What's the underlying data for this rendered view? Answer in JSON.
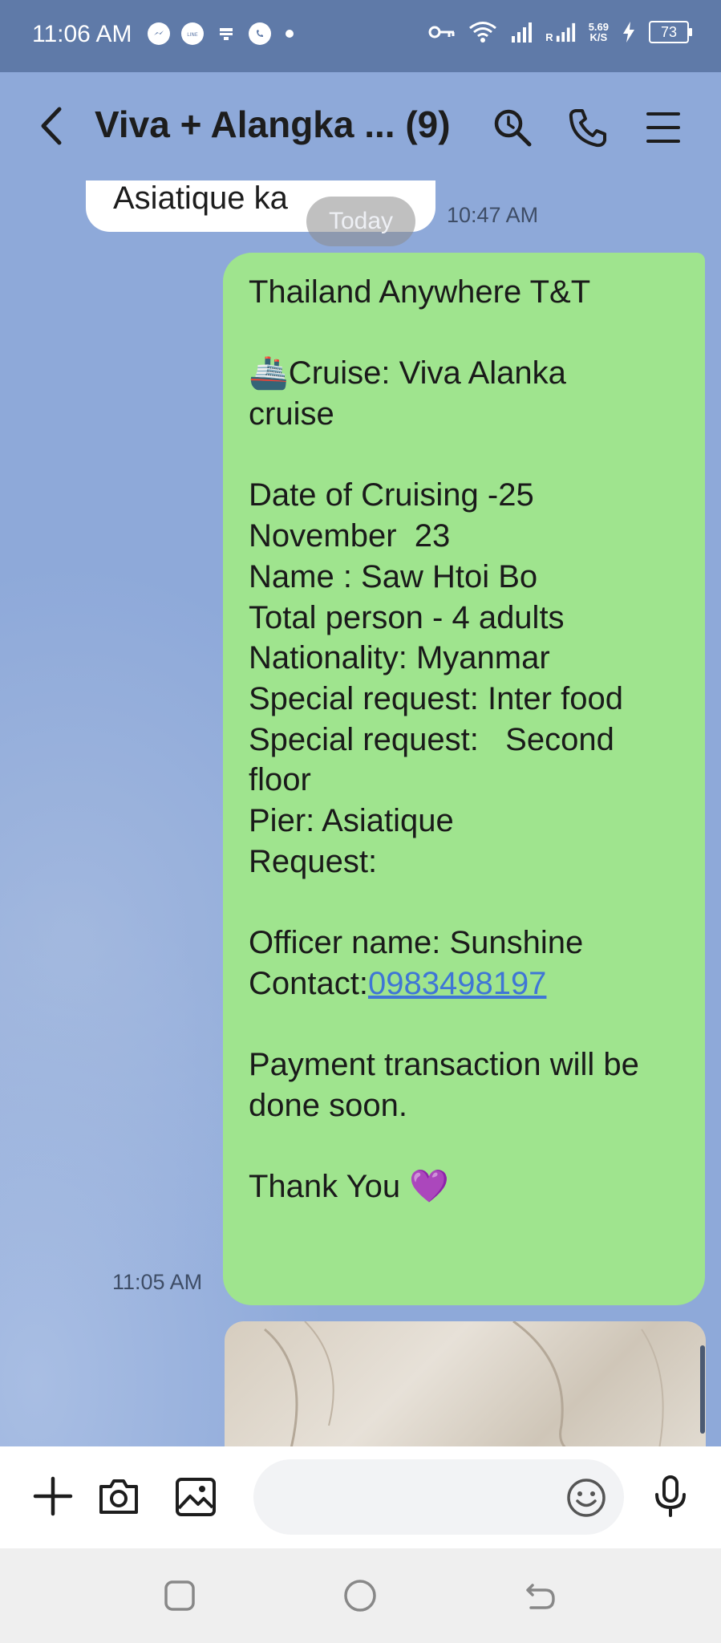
{
  "status_bar": {
    "time": "11:06 AM",
    "left_icons": [
      "messenger-icon",
      "line-icon",
      "notification-icon",
      "viber-icon"
    ],
    "network_speed": "5.69",
    "network_speed_unit": "K/S",
    "roaming_label": "R",
    "battery": "73"
  },
  "header": {
    "title": "Viva + Alangka ... (9)"
  },
  "messages": {
    "prev_text": "Asiatique ka",
    "date_separator": "Today",
    "prev_time": "10:47 AM",
    "main_time": "11:05 AM",
    "main_lines": [
      "Thailand Anywhere T&T",
      "",
      "🚢Cruise: Viva Alanka",
      "cruise",
      "",
      "Date of Cruising -25",
      "November  23",
      "Name : Saw Htoi Bo",
      "Total person - 4 adults",
      "Nationality: Myanmar",
      "Special request: Inter food",
      "Special request:   Second",
      "floor",
      "Pier: Asiatique",
      "Request:",
      "",
      "Officer name: Sunshine"
    ],
    "contact_label": "Contact:",
    "contact_number": "0983498197",
    "end_lines": [
      "",
      "Payment transaction will be",
      "done soon.",
      "",
      "Thank You 💜"
    ]
  },
  "input": {
    "placeholder": ""
  },
  "colors": {
    "chat_background": "#8ea9d9",
    "status_bar": "#5f7aa8",
    "sent_bubble": "#9fe48e",
    "link": "#3f76d6"
  }
}
